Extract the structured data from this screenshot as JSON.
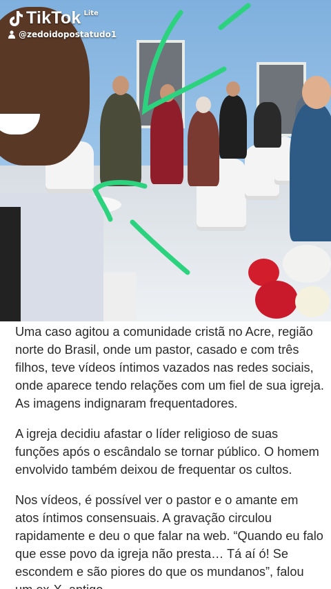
{
  "watermark": {
    "brand": "TikTok",
    "brand_suffix": "Lite",
    "username": "@zedoidopostatudo1"
  },
  "photo": {
    "description_icon": "video-frame"
  },
  "colors": {
    "scribble": "#2dd27f",
    "text": "#2a2a2a"
  },
  "article": {
    "paragraphs": [
      "Uma caso agitou a comunidade cristã no Acre, região norte do Brasil, onde um pastor, casado e com três filhos, teve vídeos íntimos vazados nas redes sociais, onde aparece tendo relações com um fiel de sua igreja. As imagens indignaram frequentadores.",
      "A igreja decidiu afastar o líder religioso de suas funções após o escândalo se tornar público. O homem envolvido também deixou de frequentar os cultos.",
      "Nos vídeos, é possível ver o pastor e o amante em atos íntimos consensuais. A gravação circulou rapidamente e deu o que falar na web. “Quando eu falo que esse povo da igreja não presta… Tá aí ó! Se escondem e são piores do que os mundanos”, falou um ex-X, antigo"
    ]
  }
}
